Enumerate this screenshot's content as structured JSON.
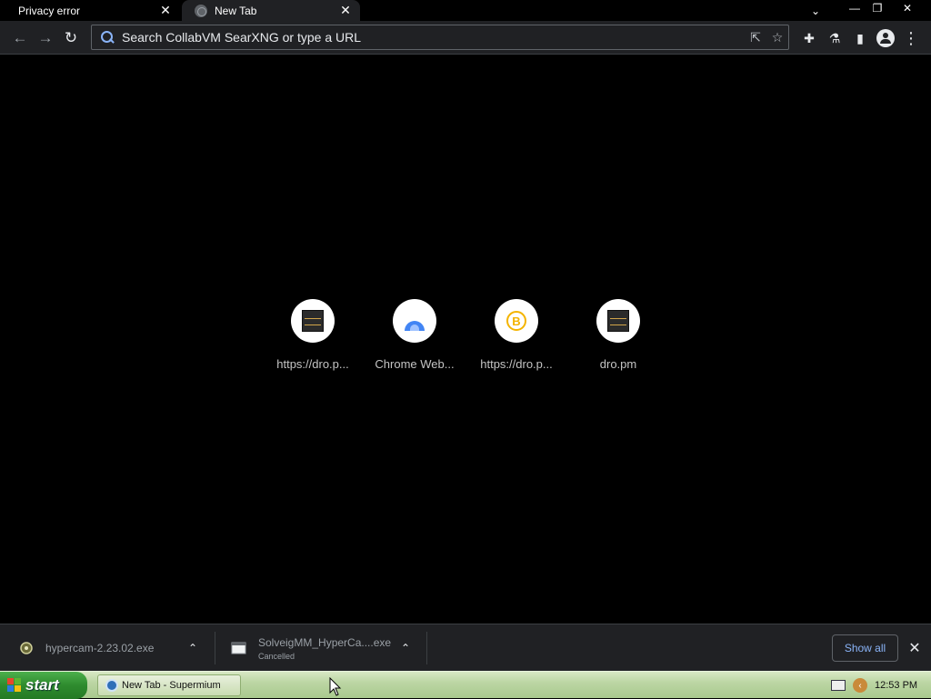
{
  "tabs": [
    {
      "title": "Privacy error",
      "close": "✕"
    },
    {
      "title": "New Tab",
      "close": "✕"
    }
  ],
  "tab_search": "⌄",
  "window_buttons": {
    "minimize": "—",
    "restore": "❐",
    "close": "✕"
  },
  "toolbar": {
    "back": "←",
    "forward": "→",
    "reload": "↻",
    "omnibox_placeholder": "Search CollabVM SearXNG or type a URL",
    "share": "⇱",
    "bookmark": "☆",
    "extensions": "✚",
    "labs": "⚗",
    "side_panel": "▮",
    "menu": "⋮"
  },
  "shortcuts": [
    {
      "label": "https://dro.p...",
      "icon": "dro-favicon"
    },
    {
      "label": "Chrome Web...",
      "icon": "chrome-web-store-icon"
    },
    {
      "label": "https://dro.p...",
      "icon": "b-coin-icon"
    },
    {
      "label": "dro.pm",
      "icon": "dro-favicon"
    }
  ],
  "downloads": {
    "items": [
      {
        "name": "hypercam-2.23.02.exe",
        "status": ""
      },
      {
        "name": "SolveigMM_HyperCa....exe",
        "status": "Cancelled"
      }
    ],
    "caret": "⌃",
    "show_all": "Show all",
    "close": "✕"
  },
  "taskbar": {
    "start": "start",
    "task_item": "New Tab - Supermium",
    "clock": "12:53 PM",
    "tray_arrow": "‹"
  },
  "colors": {
    "accent": "#8ab4f8",
    "toolbar_bg": "#202124",
    "page_bg": "#000000",
    "taskbar_green": "#bcd6a4",
    "start_green": "#2e8b2e"
  }
}
